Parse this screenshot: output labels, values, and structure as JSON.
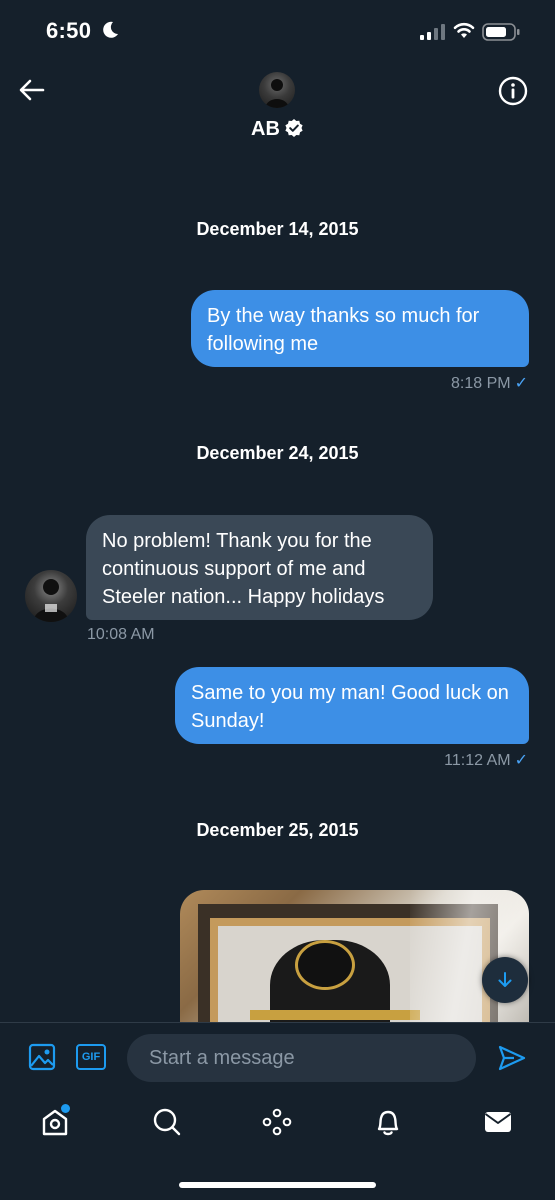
{
  "status_bar": {
    "time": "6:50"
  },
  "header": {
    "name": "AB"
  },
  "conversation": [
    {
      "date": "December 14, 2015"
    },
    {
      "direction": "out",
      "text": "By the way thanks so much for following me",
      "time": "8:18 PM"
    },
    {
      "date": "December 24, 2015"
    },
    {
      "direction": "in",
      "text": "No problem! Thank you for the continuous support of me and Steeler nation... Happy holidays",
      "time": "10:08 AM"
    },
    {
      "direction": "out",
      "text": "Same to you my man! Good luck on Sunday!",
      "time": "11:12 AM"
    },
    {
      "date": "December 25, 2015"
    }
  ],
  "read_check": "✓",
  "composer": {
    "gif_label": "GIF",
    "placeholder": "Start a message"
  },
  "colors": {
    "background": "#15202b",
    "accent": "#1d9bf0",
    "outgoing_bubble": "#3d8fe6",
    "incoming_bubble": "#3a4856",
    "meta_text": "#8b98a5"
  },
  "icons": {
    "back": "arrow-left-icon",
    "info": "info-icon",
    "verified": "verified-badge-icon",
    "scroll": "arrow-down-icon",
    "media": "image-icon",
    "gif": "gif-icon",
    "send": "send-icon",
    "tabs": [
      "home-icon",
      "search-icon",
      "spaces-icon",
      "bell-icon",
      "mail-icon"
    ]
  }
}
